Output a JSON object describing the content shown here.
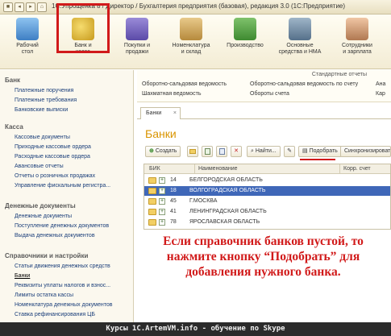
{
  "titlebar": {
    "title": "1С:Упрощенка 8 / Директор / Бухгалтерия предприятия (базовая), редакция 3.0 (1С:Предприятие)"
  },
  "toolbar": {
    "items": [
      {
        "label1": "Рабочий",
        "label2": "стол"
      },
      {
        "label1": "Банк и",
        "label2": "касса"
      },
      {
        "label1": "Покупки и",
        "label2": "продажи"
      },
      {
        "label1": "Номенклатура",
        "label2": "и склад"
      },
      {
        "label1": "Производство",
        "label2": ""
      },
      {
        "label1": "Основные",
        "label2": "средства и НМА"
      },
      {
        "label1": "Сотрудники",
        "label2": "и зарплата"
      }
    ]
  },
  "sidebar": {
    "sections": [
      {
        "title": "Банк",
        "links": [
          "Платежные поручения",
          "Платежные требования",
          "Банковские выписки"
        ]
      },
      {
        "title": "Касса",
        "links": [
          "Кассовые документы",
          "Приходные кассовые ордера",
          "Расходные кассовые ордера",
          "Авансовые отчеты",
          "Отчеты о розничных продажах",
          "Управление фискальным регистра..."
        ]
      },
      {
        "title": "Денежные документы",
        "links": [
          "Денежные документы",
          "Поступление денежных документов",
          "Выдача денежных документов"
        ]
      },
      {
        "title": "Справочники и настройки",
        "links": [
          "Статьи движения денежных средств",
          "Банки",
          "Реквизиты уплаты налогов и взнос...",
          "Лимиты остатка кассы",
          "Номенклатура денежных документов",
          "Ставка рефинансирования ЦБ"
        ]
      }
    ]
  },
  "reports": {
    "header": "Стандартные отчеты",
    "row1": [
      "Оборотно-сальдовая ведомость",
      "Оборотно-сальдовая ведомость по счету",
      "Ана"
    ],
    "row2": [
      "Шахматная ведомость",
      "Обороты счета",
      "Кар"
    ]
  },
  "tab": {
    "label": "Банки",
    "close": "×"
  },
  "page": {
    "title": "Банки"
  },
  "actions": {
    "create": "Создать",
    "find": "Найти...",
    "pick": "Подобрать",
    "sync": "Синхронизироват"
  },
  "grid": {
    "columns": [
      "БИК",
      "Наименование",
      "Корр. счет"
    ],
    "rows": [
      {
        "code": "14",
        "name": "БЕЛГОРОДСКАЯ ОБЛАСТЬ",
        "selected": false
      },
      {
        "code": "18",
        "name": "ВОЛГОГРАДСКАЯ ОБЛАСТЬ",
        "selected": true
      },
      {
        "code": "45",
        "name": "Г.МОСКВА",
        "selected": false
      },
      {
        "code": "41",
        "name": "ЛЕНИНГРАДСКАЯ ОБЛАСТЬ",
        "selected": false
      },
      {
        "code": "78",
        "name": "ЯРОСЛАВСКАЯ ОБЛАСТЬ",
        "selected": false
      }
    ]
  },
  "callout": {
    "lines": [
      "Если справочник банков пустой, то",
      "нажмите кнопку “Подобрать” для",
      "добавления нужного банка."
    ]
  },
  "footer": {
    "text": "Курсы 1С.ArtemVM.info - обучение по Skype"
  },
  "colors": {
    "accent": "#d11a1a",
    "title": "#d99400",
    "selection": "#3f67b8"
  }
}
